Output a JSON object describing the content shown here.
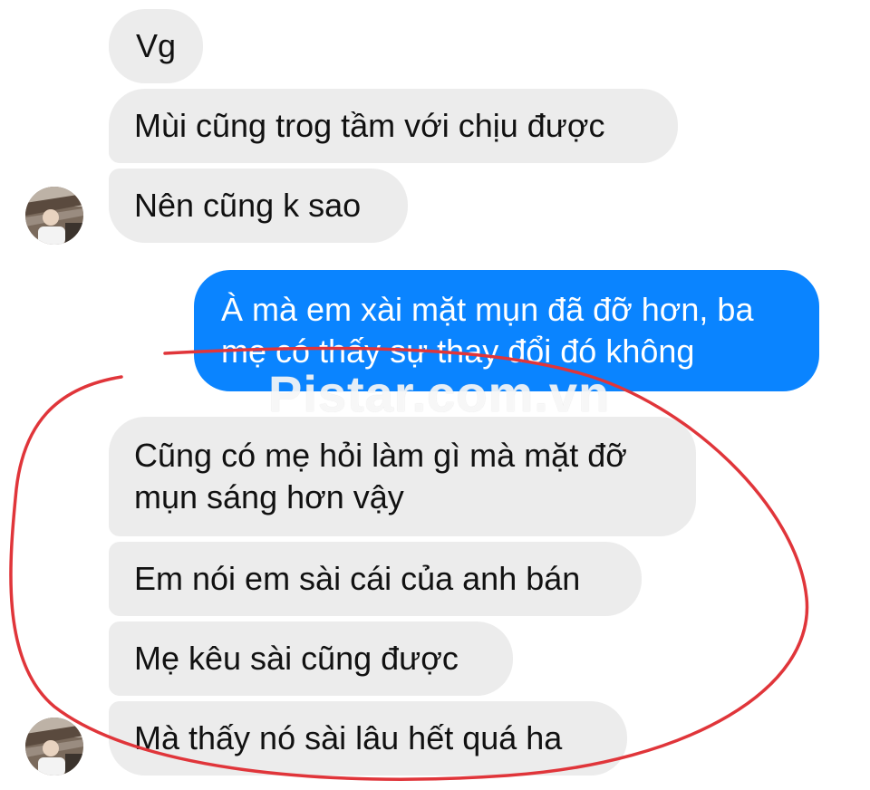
{
  "messages": [
    {
      "side": "incoming",
      "text": "Vg"
    },
    {
      "side": "incoming",
      "text": "Mùi cũng trog tầm với chịu được"
    },
    {
      "side": "incoming",
      "text": "Nên cũng k sao"
    },
    {
      "side": "outgoing",
      "text": "À mà em xài mặt mụn đã đỡ hơn, ba\nmẹ có thấy sự thay đổi đó không"
    },
    {
      "side": "incoming",
      "text": "Cũng có mẹ hỏi làm gì mà mặt đỡ\nmụn sáng hơn vậy"
    },
    {
      "side": "incoming",
      "text": "Em nói em sài cái của anh bán"
    },
    {
      "side": "incoming",
      "text": "Mẹ kêu sài cũng được"
    },
    {
      "side": "incoming",
      "text": "Mà thấy nó sài lâu hết quá ha"
    }
  ],
  "watermark": "Pistar.com.vn",
  "colors": {
    "incoming_bubble": "#ececec",
    "outgoing_bubble": "#0a84ff",
    "annotation_stroke": "#e0353a"
  },
  "icons": {
    "contact_avatar": "avatar-photo"
  }
}
